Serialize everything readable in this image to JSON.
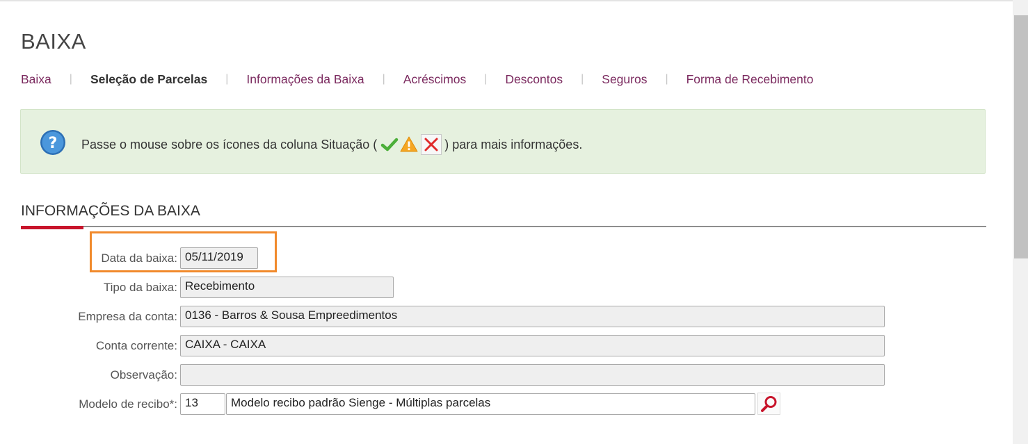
{
  "page": {
    "title": "BAIXA"
  },
  "tabs": [
    {
      "label": "Baixa",
      "active": false
    },
    {
      "label": "Seleção de Parcelas",
      "active": true
    },
    {
      "label": "Informações da Baixa",
      "active": false
    },
    {
      "label": "Acréscimos",
      "active": false
    },
    {
      "label": "Descontos",
      "active": false
    },
    {
      "label": "Seguros",
      "active": false
    },
    {
      "label": "Forma de Recebimento",
      "active": false
    }
  ],
  "tab_separator": "|",
  "info": {
    "text_before": "Passe o mouse sobre os ícones da coluna Situação (",
    "text_after": ") para mais informações.",
    "icons": [
      "check-icon",
      "warning-icon",
      "error-x-icon"
    ]
  },
  "section": {
    "title": "INFORMAÇÕES DA BAIXA"
  },
  "form": {
    "data_baixa": {
      "label": "Data da baixa:",
      "value": "05/11/2019"
    },
    "tipo_baixa": {
      "label": "Tipo da baixa:",
      "value": "Recebimento"
    },
    "empresa_conta": {
      "label": "Empresa da conta:",
      "value": "0136 - Barros & Sousa Empreedimentos"
    },
    "conta_corrente": {
      "label": "Conta corrente:",
      "value": "CAIXA - CAIXA"
    },
    "observacao": {
      "label": "Observação:",
      "value": ""
    },
    "modelo_recibo": {
      "label": "Modelo de recibo*:",
      "code": "13",
      "description": "Modelo recibo padrão Sienge - Múltiplas parcelas"
    }
  },
  "colors": {
    "tab_link": "#7b2a5f",
    "info_background": "#e6f1df",
    "section_accent": "#c8142b",
    "highlight_border": "#f18a2c"
  }
}
